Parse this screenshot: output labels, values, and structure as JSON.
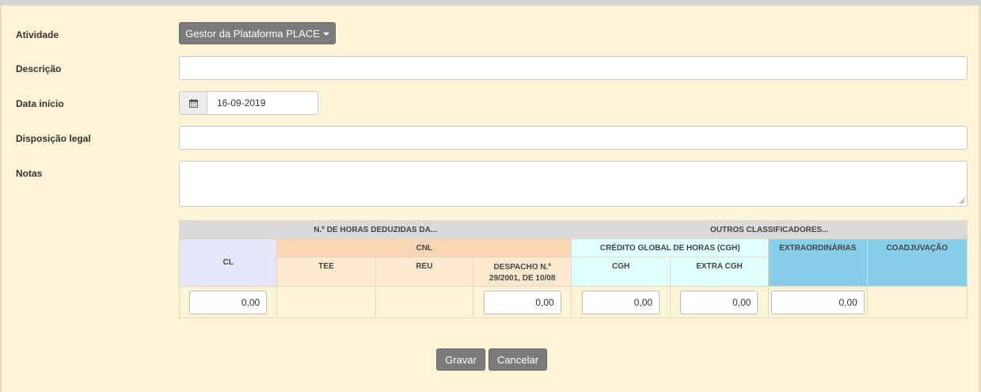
{
  "form": {
    "atividade_label": "Atividade",
    "atividade_value": "Gestor da Plataforma PLACE",
    "descricao_label": "Descrição",
    "descricao_value": "",
    "data_inicio_label": "Data início",
    "data_inicio_value": "16-09-2019",
    "disposicao_label": "Disposição legal",
    "disposicao_value": "",
    "notas_label": "Notas",
    "notas_value": ""
  },
  "hours_table": {
    "group_deduzidas": "N.º DE HORAS DEDUZIDAS DA...",
    "group_outros": "OUTROS CLASSIFICADORES...",
    "cl": "CL",
    "cnl": "CNL",
    "tee": "TEE",
    "reu": "REU",
    "despacho": "DESPACHO N.º 29/2001, DE 10/08",
    "cgh_group": "CRÉDITO GLOBAL DE HORAS (CGH)",
    "cgh": "CGH",
    "extra_cgh": "EXTRA CGH",
    "extraordinarias": "EXTRAORDINÁRIAS",
    "coadjuvacao": "COADJUVAÇÃO",
    "values": {
      "cl": "0,00",
      "despacho": "0,00",
      "cgh": "0,00",
      "extra_cgh": "0,00",
      "extraordinarias": "0,00"
    }
  },
  "actions": {
    "save": "Gravar",
    "cancel": "Cancelar"
  },
  "colors": {
    "background": "#fdf3d6",
    "button": "#7b7b7b",
    "header_grey": "#dadada",
    "header_lavender": "#e6e6fa",
    "header_peach": "#fcd5b5",
    "header_cyan": "#e0ffff",
    "header_blue": "#87ceeb"
  },
  "icons": {
    "date_addon": "calendar-icon"
  }
}
